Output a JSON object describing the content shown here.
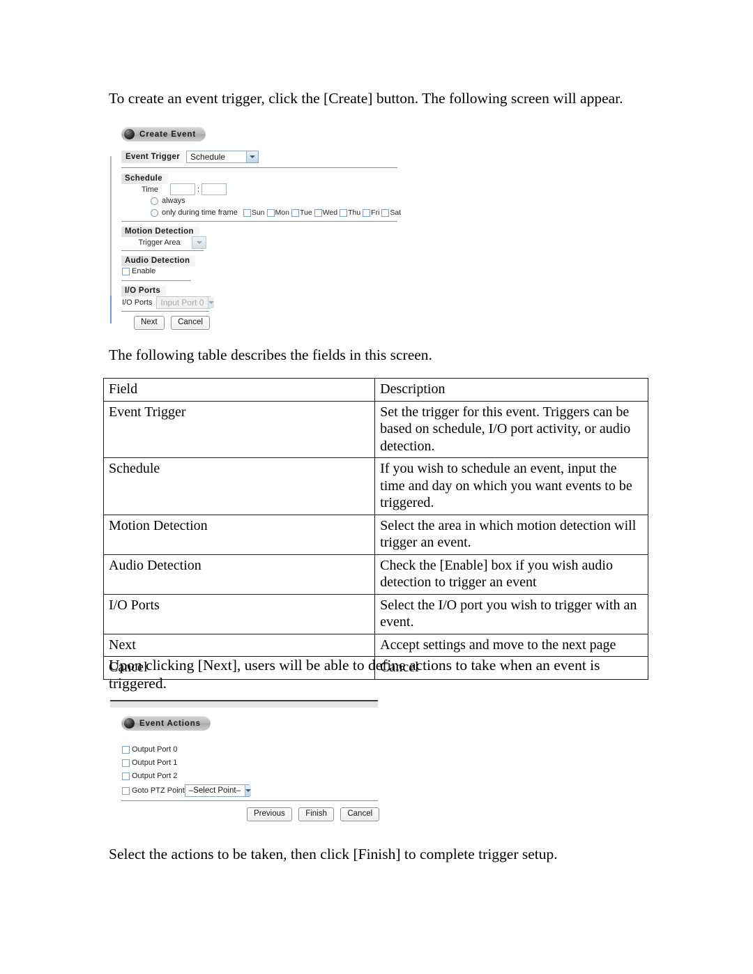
{
  "document": {
    "intro_paragraph": "To create an event trigger, click the [Create] button. The following screen will appear.",
    "table_lead_paragraph": "The following table describes the fields in this screen.",
    "next_paragraph": "Upon clicking [Next], users will be able to define actions to take when an event is triggered.",
    "finish_paragraph": "Select the actions to be taken, then click [Finish] to complete trigger setup."
  },
  "field_table": {
    "headers": [
      "Field",
      "Description"
    ],
    "rows": [
      {
        "field": "Event Trigger",
        "description": "Set the trigger for this event. Triggers can be based on schedule, I/O port activity, or audio detection."
      },
      {
        "field": "Schedule",
        "description": "If you wish to schedule an event, input the time and day on which you want events to be triggered."
      },
      {
        "field": "Motion Detection",
        "description": "Select the area in which motion detection will trigger an event."
      },
      {
        "field": "Audio Detection",
        "description": "Check the [Enable] box if you wish audio detection to trigger an event"
      },
      {
        "field": "I/O Ports",
        "description": "Select the I/O port you wish to trigger with an event."
      },
      {
        "field": "Next",
        "description": "Accept settings and move to the next page"
      },
      {
        "field": "Cancel",
        "description": "Cancel"
      }
    ]
  },
  "create_event_screen": {
    "title": "Create Event",
    "event_trigger": {
      "label": "Event Trigger",
      "selected": "Schedule"
    },
    "schedule": {
      "heading": "Schedule",
      "time_label": "Time",
      "time_hour": "",
      "time_minute": "",
      "time_separator": ":",
      "option_always": "always",
      "option_time_frame": "only during time frame",
      "days": [
        "Sun",
        "Mon",
        "Tue",
        "Wed",
        "Thu",
        "Fri",
        "Sat"
      ]
    },
    "motion_detection": {
      "heading": "Motion Detection",
      "trigger_area_label": "Trigger Area",
      "trigger_area_value": ""
    },
    "audio_detection": {
      "heading": "Audio Detection",
      "enable_label": "Enable"
    },
    "io_ports": {
      "heading": "I/O Ports",
      "label": "I/O Ports",
      "selected": "Input Port 0"
    },
    "buttons": {
      "next": "Next",
      "cancel": "Cancel"
    }
  },
  "event_actions_screen": {
    "title": "Event Actions",
    "checkboxes": [
      "Output Port 0",
      "Output Port 1",
      "Output Port 2"
    ],
    "ptz": {
      "label": "Goto PTZ Point",
      "selected": "–Select Point–"
    },
    "buttons": {
      "previous": "Previous",
      "finish": "Finish",
      "cancel": "Cancel"
    }
  },
  "colors": {
    "accent_blue": "#6f9bd1",
    "section_grey": "#e2e2e2",
    "rule_grey": "#8f8f8f",
    "table_border": "#1a1a1a"
  }
}
